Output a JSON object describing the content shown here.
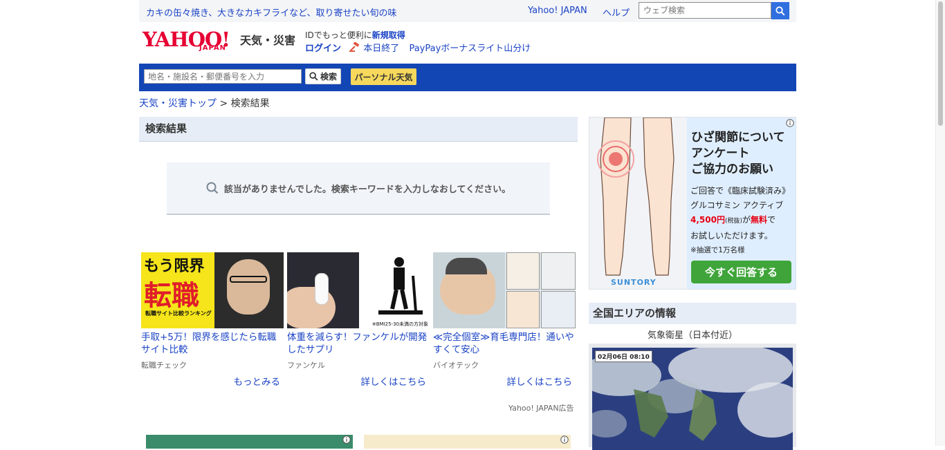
{
  "top": {
    "promo": "カキの缶々焼き、大きなカキフライなど、取り寄せたい旬の味",
    "yahoo_link": "Yahoo! JAPAN",
    "help_link": "ヘルプ",
    "search_placeholder": "ウェブ検索"
  },
  "header": {
    "logo": "YAHOO!",
    "logo_sub": "JAPAN",
    "service": "天気・災害",
    "register_text": "IDでもっと便利に",
    "register_link": "新規取得",
    "login": "ログイン",
    "notice": "本日終了",
    "campaign": "PayPayボーナスライト山分け"
  },
  "nav": {
    "location_placeholder": "地名・施設名・郵便番号を入力",
    "search_button": "検索",
    "personal_button": "パーソナル天気"
  },
  "breadcrumb": {
    "home": "天気・災害トップ",
    "sep": ">",
    "current": "検索結果"
  },
  "results": {
    "heading": "検索結果",
    "empty_message": "該当がありませんでした。検索キーワードを入力しなおしてください。"
  },
  "ads": [
    {
      "img_line1": "もう限界",
      "img_line2": "転職",
      "img_small": "転職サイト比較ランキング",
      "title": "手取+5万！限界を感じたら転職サイト比較",
      "source": "転職チェック",
      "more": "もっとみる"
    },
    {
      "img_small": "※BMI25-30未満の方対象",
      "title": "体重を減らす！ファンケルが開発したサプリ",
      "source": "ファンケル",
      "more": "詳しくはこちら"
    },
    {
      "title": "≪完全個室≫育毛専門店！通いやすくて安心",
      "source": "バイオテック",
      "more": "詳しくはこちら"
    }
  ],
  "ad_label": "Yahoo! JAPAN広告",
  "side_ad": {
    "heading": [
      "ひざ関節について",
      "アンケート",
      "ご協力のお願い"
    ],
    "line1": "ご回答で《臨床試験済み》",
    "line2": "グルコサミン アクティブ",
    "price": "4,500円",
    "tax": "(税抜)",
    "ga": "が",
    "free": "無料",
    "de": "で",
    "line4": "お試しいただけます。",
    "note": "※抽選で1万名様",
    "button": "今すぐ回答する",
    "brand": "SUNTORY"
  },
  "area": {
    "heading": "全国エリアの情報",
    "sat_label": "気象衛星（日本付近）",
    "timestamp": "02月06日 08:10"
  }
}
